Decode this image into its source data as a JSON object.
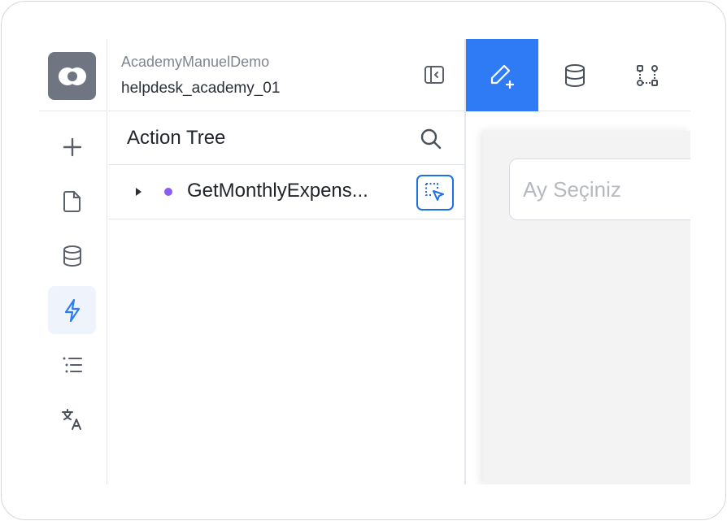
{
  "app": {
    "name": "AcademyManuelDemo",
    "project": "helpdesk_academy_01"
  },
  "rail": {
    "items": [
      {
        "icon": "plus-icon",
        "name": "add"
      },
      {
        "icon": "file-icon",
        "name": "pages"
      },
      {
        "icon": "database-icon",
        "name": "data"
      },
      {
        "icon": "lightning-icon",
        "name": "actions",
        "active": true
      },
      {
        "icon": "list-icon",
        "name": "list"
      },
      {
        "icon": "translate-icon",
        "name": "translations"
      }
    ]
  },
  "action_tree": {
    "title": "Action Tree",
    "items": [
      {
        "label": "GetMonthlyExpens...",
        "status_color": "#8b5cf6"
      }
    ]
  },
  "toolbar": {
    "tools": [
      {
        "icon": "edit-plus-icon",
        "active": true
      },
      {
        "icon": "database-icon"
      },
      {
        "icon": "flow-icon"
      }
    ]
  },
  "canvas": {
    "input_placeholder": "Ay Seçiniz"
  },
  "colors": {
    "accent": "#2f7bf5",
    "active_bg": "#eef3fc",
    "dot": "#8b5cf6"
  }
}
